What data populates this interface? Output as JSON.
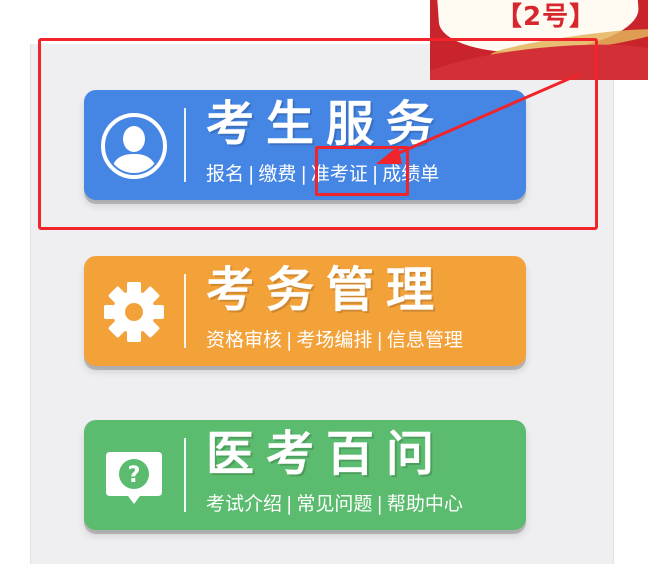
{
  "banner": {
    "label": "【2号】"
  },
  "cards": [
    {
      "title": "考生服务",
      "icon": "user-avatar-icon",
      "color": "#4585e4",
      "links": [
        "报名",
        "缴费",
        "准考证",
        "成绩单"
      ]
    },
    {
      "title": "考务管理",
      "icon": "gear-icon",
      "color": "#f3a23a",
      "links": [
        "资格审核",
        "考场编排",
        "信息管理"
      ]
    },
    {
      "title": "医考百问",
      "icon": "help-bubble-icon",
      "color": "#5bbb6e",
      "links": [
        "考试介绍",
        "常见问题",
        "帮助中心"
      ]
    }
  ],
  "separator": "|",
  "annotation": {
    "color": "#f0242a",
    "highlighted_link": "准考证"
  }
}
